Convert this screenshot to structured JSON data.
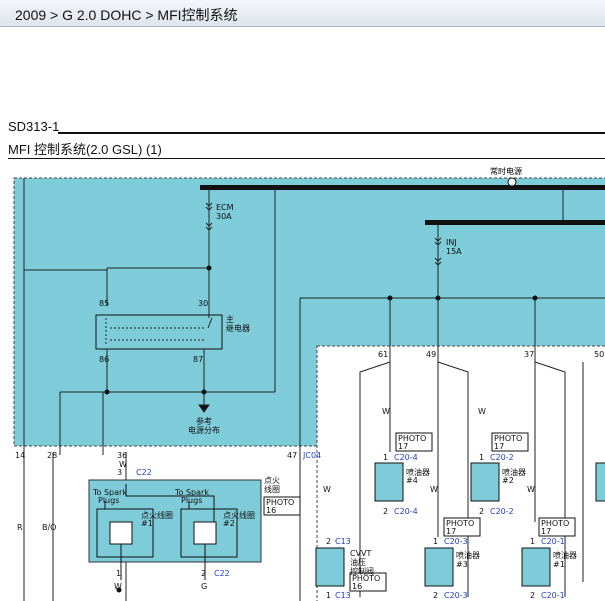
{
  "breadcrumb": "2009 > G 2.0 DOHC > MFI控制系统",
  "section_code": "SD313-1",
  "page_title": "MFI 控制系统(2.0 GSL) (1)",
  "labels": {
    "always_power": "常时电源",
    "ecm_fuse": "ECM",
    "ecm_amp": "30A",
    "inj_fuse": "INJ",
    "inj_amp": "15A",
    "pin85": "85",
    "pin30": "30",
    "pin86": "86",
    "pin87": "87",
    "relay1": "主",
    "relay2": "继电器",
    "ref1": "参考",
    "ref2": "电源分布",
    "t14": "14",
    "t28": "28",
    "t36": "36",
    "t47": "47",
    "jc04": "JC04",
    "p3": "3",
    "c22": "C22",
    "w_top": "W",
    "ignition_label1": "点火",
    "ignition_label2": "线圈",
    "ph_ignition_a": "PHOTO",
    "ph_ignition_b": "16",
    "to_spark_left1": "To Spark",
    "to_spark_left2": "Plugs",
    "to_spark_right1": "To Spark",
    "to_spark_right2": "Plugs",
    "coil1_a": "点火线圈",
    "coil1_b": "#1",
    "coil2_a": "点火线圈",
    "coil2_b": "#2",
    "p1_left": "1",
    "p2_right": "2",
    "c22_bottom": "C22",
    "w_left": "W",
    "g_right": "G",
    "wire_r": "R",
    "wire_bo": "B/O",
    "n61": "61",
    "n49": "49",
    "n37": "37",
    "n50": "50",
    "wire_w1": "W",
    "wire_w2": "W",
    "wire_w3": "W",
    "wire_w4": "W",
    "wire_w5": "W",
    "ph17_a": "PHOTO",
    "ph17_b": "17",
    "p1_c204": "1",
    "c204": "C20-4",
    "inj4_a": "喷油器",
    "inj4_b": "#4",
    "p2_c204": "2",
    "c204b": "C20-4",
    "ph17_2a": "PHOTO",
    "ph17_2b": "17",
    "p1_c202": "1",
    "c202": "C20-2",
    "inj2_a": "喷油器",
    "inj2_b": "#2",
    "p2_c202": "2",
    "c202b": "C20-2",
    "p2_c13": "2",
    "c13": "C13",
    "cvvt1": "CVVT",
    "cvvt2": "油压",
    "cvvt3": "控制阀",
    "ph16_a": "PHOTO",
    "ph16_b": "16",
    "p1_c13": "1",
    "c13b": "C13",
    "ph17_3a": "PHOTO",
    "ph17_3b": "17",
    "p1_c203": "1",
    "c203": "C20-3",
    "inj3_a": "喷油器",
    "inj3_b": "#3",
    "p2_c203": "2",
    "c203b": "C20-3",
    "ph17_4a": "PHOTO",
    "ph17_4b": "17",
    "p1_c201": "1",
    "c201": "C20-1",
    "inj1_a": "喷油器",
    "inj1_b": "#1",
    "p2_c201": "2",
    "c201b": "C20-1"
  },
  "colors": {
    "ecm_fill": "#7ecbd9",
    "wire": "#222222",
    "connector_blue": "#1d3fd0"
  }
}
